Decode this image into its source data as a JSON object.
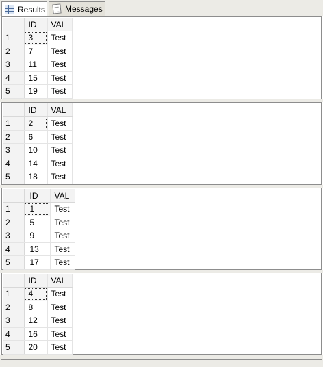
{
  "tabs": [
    {
      "label": "Results",
      "icon": "results-grid-icon",
      "active": true
    },
    {
      "label": "Messages",
      "icon": "messages-icon",
      "active": false
    }
  ],
  "result_sets": [
    {
      "columns": [
        "ID",
        "VAL"
      ],
      "rows": [
        {
          "num": "1",
          "id": "3",
          "val": "Test"
        },
        {
          "num": "2",
          "id": "7",
          "val": "Test"
        },
        {
          "num": "3",
          "id": "11",
          "val": "Test"
        },
        {
          "num": "4",
          "id": "15",
          "val": "Test"
        },
        {
          "num": "5",
          "id": "19",
          "val": "Test"
        }
      ]
    },
    {
      "columns": [
        "ID",
        "VAL"
      ],
      "rows": [
        {
          "num": "1",
          "id": "2",
          "val": "Test"
        },
        {
          "num": "2",
          "id": "6",
          "val": "Test"
        },
        {
          "num": "3",
          "id": "10",
          "val": "Test"
        },
        {
          "num": "4",
          "id": "14",
          "val": "Test"
        },
        {
          "num": "5",
          "id": "18",
          "val": "Test"
        }
      ]
    },
    {
      "columns": [
        "ID",
        "VAL"
      ],
      "rows": [
        {
          "num": "1",
          "id": "1",
          "val": "Test"
        },
        {
          "num": "2",
          "id": "5",
          "val": "Test"
        },
        {
          "num": "3",
          "id": "9",
          "val": "Test"
        },
        {
          "num": "4",
          "id": "13",
          "val": "Test"
        },
        {
          "num": "5",
          "id": "17",
          "val": "Test"
        }
      ]
    },
    {
      "columns": [
        "ID",
        "VAL"
      ],
      "rows": [
        {
          "num": "1",
          "id": "4",
          "val": "Test"
        },
        {
          "num": "2",
          "id": "8",
          "val": "Test"
        },
        {
          "num": "3",
          "id": "12",
          "val": "Test"
        },
        {
          "num": "4",
          "id": "16",
          "val": "Test"
        },
        {
          "num": "5",
          "id": "20",
          "val": "Test"
        }
      ]
    }
  ]
}
